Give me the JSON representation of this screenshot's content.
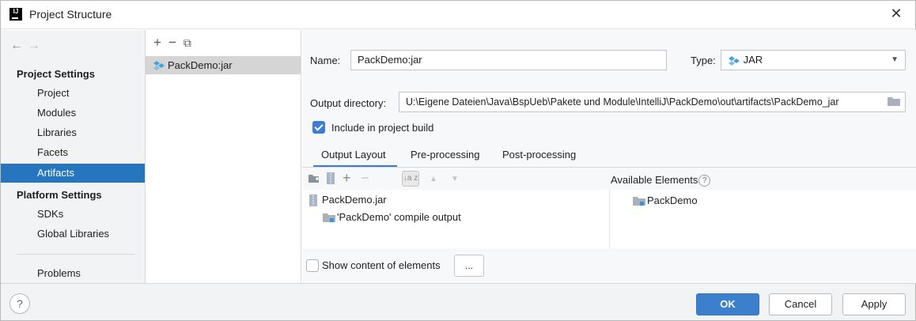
{
  "window": {
    "title": "Project Structure",
    "close_glyph": "✕",
    "app_icon_letter": "IJ"
  },
  "sidebar": {
    "back": "←",
    "forward": "→",
    "project_settings_header": "Project Settings",
    "project_items": [
      "Project",
      "Modules",
      "Libraries",
      "Facets",
      "Artifacts"
    ],
    "platform_settings_header": "Platform Settings",
    "platform_items": [
      "SDKs",
      "Global Libraries"
    ],
    "problems": "Problems",
    "selected": "Artifacts"
  },
  "artifacts_list": {
    "toolbar": {
      "add": "+",
      "remove": "−",
      "copy": "⧉"
    },
    "items": [
      "PackDemo:jar"
    ]
  },
  "detail": {
    "name_label": "Name:",
    "name_value": "PackDemo:jar",
    "type_label": "Type:",
    "type_value": "JAR",
    "output_dir_label": "Output directory:",
    "output_dir_value": "U:\\Eigene Dateien\\Java\\BspUeb\\Pakete und Module\\IntelliJ\\PackDemo\\out\\artifacts\\PackDemo_jar",
    "include_build_label": "Include in project build",
    "include_build_checked": true,
    "tabs": [
      "Output Layout",
      "Pre-processing",
      "Post-processing"
    ],
    "active_tab": "Output Layout",
    "layout_toolbar": {
      "add": "+",
      "remove": "−",
      "sort": "↓a z",
      "up": "▲",
      "down": "▼"
    },
    "tree": {
      "root": "PackDemo.jar",
      "child": "'PackDemo' compile output"
    },
    "available_label": "Available Elements",
    "available_help": "?",
    "available_items": [
      "PackDemo"
    ],
    "show_content_label": "Show content of elements",
    "show_content_checked": false,
    "dots_button": "..."
  },
  "footer": {
    "help": "?",
    "ok": "OK",
    "cancel": "Cancel",
    "apply": "Apply"
  },
  "colors": {
    "selection": "#2675bf",
    "accent": "#3c80cd",
    "artifact_icon": "#4aa3d8"
  }
}
